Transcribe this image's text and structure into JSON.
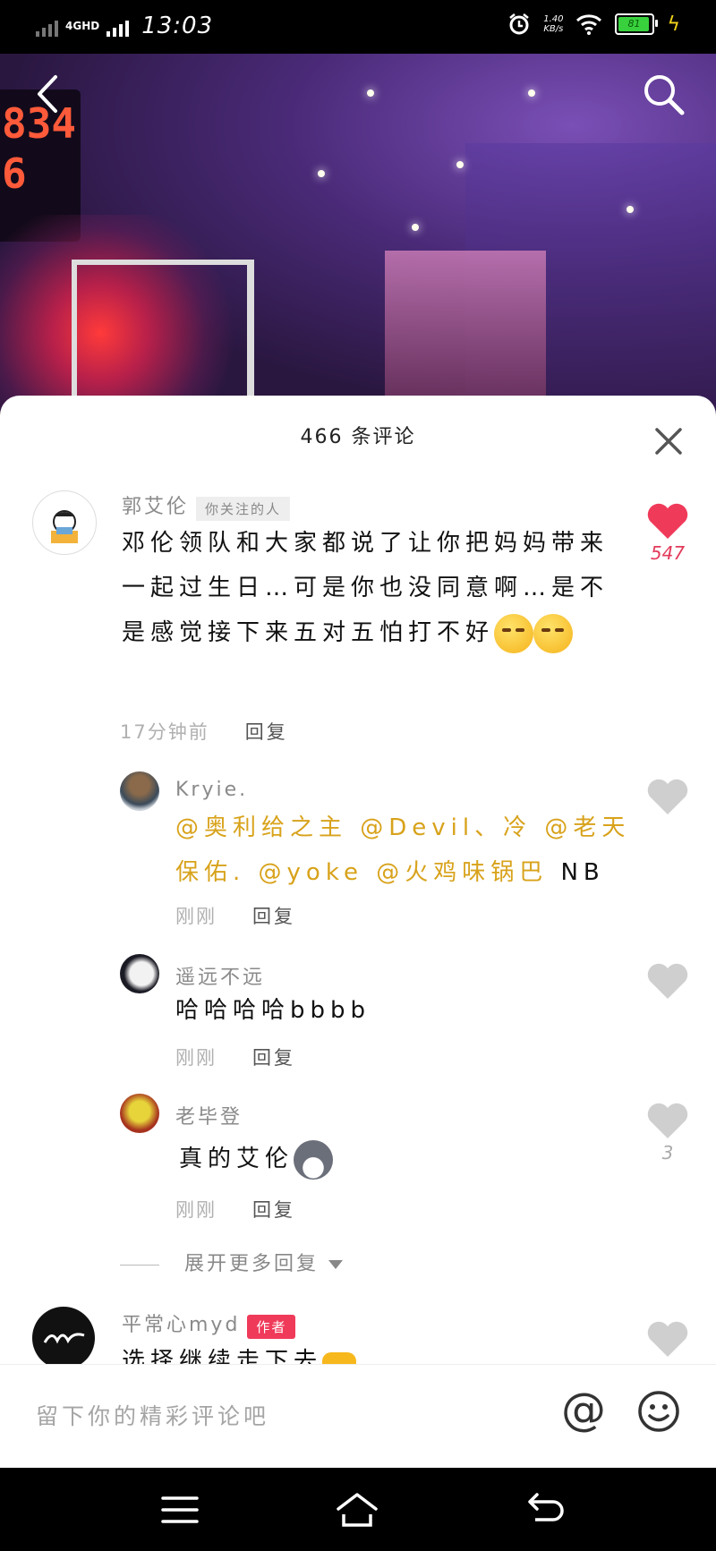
{
  "status_bar": {
    "network": "4GHD",
    "time": "13:03",
    "speed_value": "1.40",
    "speed_unit": "KB/s",
    "battery": "81"
  },
  "video": {
    "screen_text": "834\n6"
  },
  "sheet": {
    "title": "466 条评论"
  },
  "comments": [
    {
      "name": "郭艾伦",
      "tag": "你关注的人",
      "text": "邓伦领队和大家都说了让你把妈妈带来一起过生日…可是你也没同意啊…是不是感觉接下来五对五怕打不好",
      "time": "17分钟前",
      "reply": "回复",
      "likes": "547"
    }
  ],
  "replies": [
    {
      "name": "Kryie.",
      "mentions": "@奥利给之主 @Devil、冷 @老天保佑. @yoke @火鸡味锅巴",
      "tail": "NB",
      "time": "刚刚",
      "reply": "回复"
    },
    {
      "name": "遥远不远",
      "text": "哈哈哈哈bbbb",
      "time": "刚刚",
      "reply": "回复"
    },
    {
      "name": "老毕登",
      "text": "真的艾伦",
      "time": "刚刚",
      "reply": "回复",
      "likes": "3"
    }
  ],
  "expand_label": "展开更多回复",
  "author_comment": {
    "name": "平常心myd",
    "tag": "作者",
    "text": "选择继续走下去"
  },
  "input": {
    "placeholder": "留下你的精彩评论吧",
    "at_symbol": "@"
  },
  "colors": {
    "like_red": "#f03a5a",
    "mention_gold": "#d8a21a"
  }
}
